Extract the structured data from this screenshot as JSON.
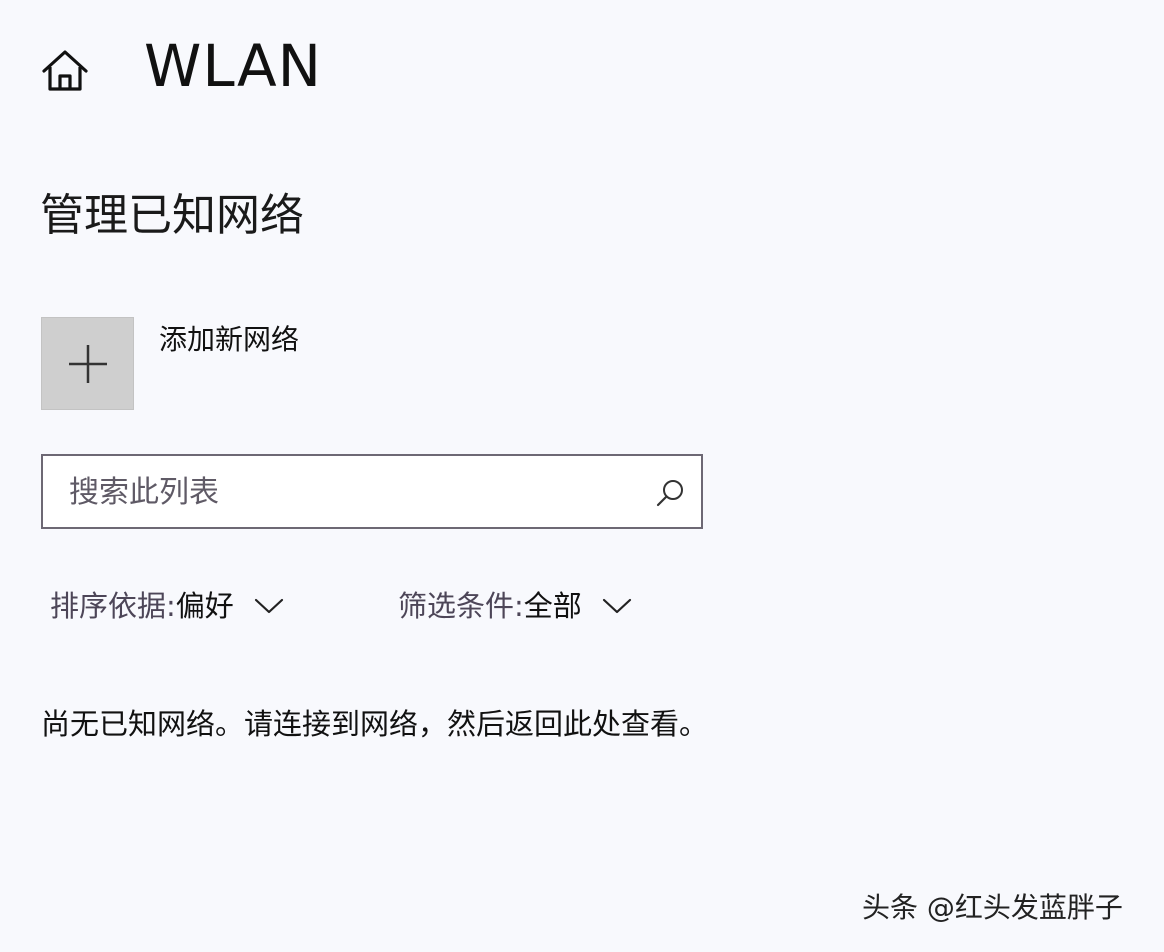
{
  "header": {
    "title": "WLAN"
  },
  "section": {
    "heading": "管理已知网络"
  },
  "add_network": {
    "label": "添加新网络",
    "icon": "plus-icon"
  },
  "search": {
    "placeholder": "搜索此列表",
    "value": "",
    "icon": "search-icon"
  },
  "sort": {
    "label": "排序依据:",
    "value": "偏好"
  },
  "filter": {
    "label": "筛选条件:",
    "value": "全部"
  },
  "empty_message": "尚无已知网络。请连接到网络，然后返回此处查看。",
  "watermark": "头条 @红头发蓝胖子",
  "colors": {
    "background": "#f8f9fd",
    "tile": "#cfcfcf",
    "search_border": "#6d6874",
    "dropdown_label": "#4d4658"
  }
}
